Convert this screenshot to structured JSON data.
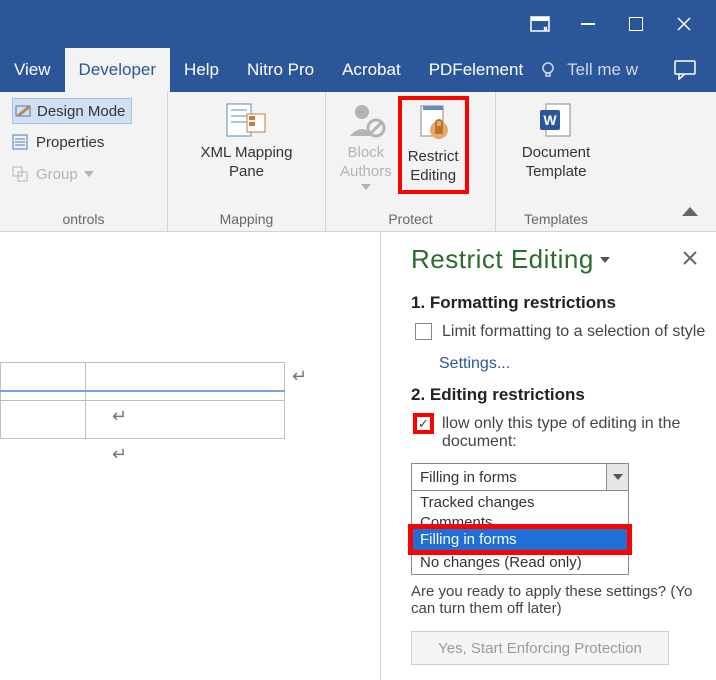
{
  "titlebar": {},
  "tabs": {
    "view": "View",
    "developer": "Developer",
    "help": "Help",
    "nitro": "Nitro Pro",
    "acrobat": "Acrobat",
    "pdfelement": "PDFelement",
    "tell_me": "Tell me w"
  },
  "ribbon": {
    "controls": {
      "design_mode": "Design Mode",
      "properties": "Properties",
      "group": "Group",
      "label": "ontrols"
    },
    "mapping": {
      "button": "XML Mapping\nPane",
      "label": "Mapping"
    },
    "protect": {
      "block_authors": "Block\nAuthors",
      "restrict_editing": "Restrict\nEditing",
      "label": "Protect"
    },
    "templates": {
      "button": "Document\nTemplate",
      "label": "Templates"
    }
  },
  "pane": {
    "title": "Restrict Editing",
    "sec1": "1. Formatting restrictions",
    "limit_formatting": "Limit formatting to a selection of style",
    "settings": "Settings...",
    "sec2": "2. Editing restrictions",
    "allow_only": "llow only this type of editing in the document:",
    "combo_value": "Filling in forms",
    "options": {
      "tracked": "Tracked changes",
      "comments": "Comments",
      "filling": "Filling in forms",
      "nochanges": "No changes (Read only)"
    },
    "apply": "Are you ready to apply these settings? (Yo can turn them off later)",
    "enforce": "Yes, Start Enforcing Protection"
  }
}
